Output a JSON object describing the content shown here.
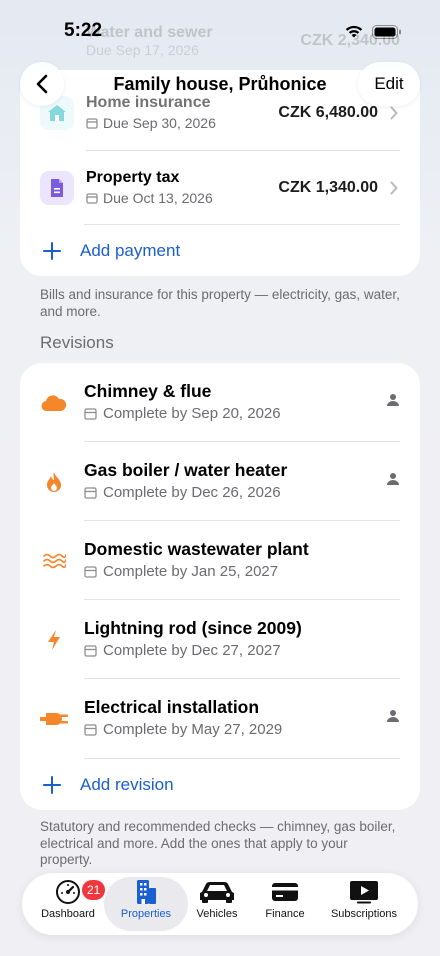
{
  "status_bar": {
    "time": "5:22"
  },
  "header": {
    "title": "Family house, Průhonice",
    "edit_label": "Edit"
  },
  "ghost_row": {
    "title": "Water and sewer",
    "due": "Due Sep 17, 2026",
    "amount": "CZK 2,340.00"
  },
  "payments": {
    "items": [
      {
        "title": "Home insurance",
        "due": "Due Sep 30, 2026",
        "amount": "CZK 6,480.00",
        "icon": "house-icon",
        "icon_color": "#25b7c4",
        "icon_bg": "#dff5f6"
      },
      {
        "title": "Property tax",
        "due": "Due Oct 13, 2026",
        "amount": "CZK 1,340.00",
        "icon": "document-icon",
        "icon_color": "#7b5ce0",
        "icon_bg": "#ebe6fb"
      }
    ],
    "add_label": "Add payment",
    "caption": "Bills and insurance for this property — electricity, gas, water, and more."
  },
  "revisions": {
    "header": "Revisions",
    "items": [
      {
        "title": "Chimney & flue",
        "due": "Complete by Sep 20, 2026",
        "icon": "cloud-icon",
        "assigned": true
      },
      {
        "title": "Gas boiler / water heater",
        "due": "Complete by Dec 26, 2026",
        "icon": "flame-icon",
        "assigned": true
      },
      {
        "title": "Domestic wastewater plant",
        "due": "Complete by Jan 25, 2027",
        "icon": "waves-icon",
        "assigned": false
      },
      {
        "title": "Lightning rod (since 2009)",
        "due": "Complete by Dec 27, 2027",
        "icon": "bolt-icon",
        "assigned": false
      },
      {
        "title": "Electrical installation",
        "due": "Complete by May 27, 2029",
        "icon": "plug-icon",
        "assigned": true
      }
    ],
    "add_label": "Add revision",
    "caption": "Statutory and recommended checks — chimney, gas boiler, electrical and more. Add the ones that apply to your property."
  },
  "tabbar": {
    "tabs": [
      {
        "label": "Dashboard",
        "icon": "gauge-icon",
        "badge": "21"
      },
      {
        "label": "Properties",
        "icon": "building-icon",
        "active": true
      },
      {
        "label": "Vehicles",
        "icon": "car-icon"
      },
      {
        "label": "Finance",
        "icon": "card-icon"
      },
      {
        "label": "Subscriptions",
        "icon": "play-icon"
      }
    ]
  },
  "colors": {
    "accent": "#1a5fd0",
    "orange": "#f5862a",
    "badge": "#f0373e"
  }
}
